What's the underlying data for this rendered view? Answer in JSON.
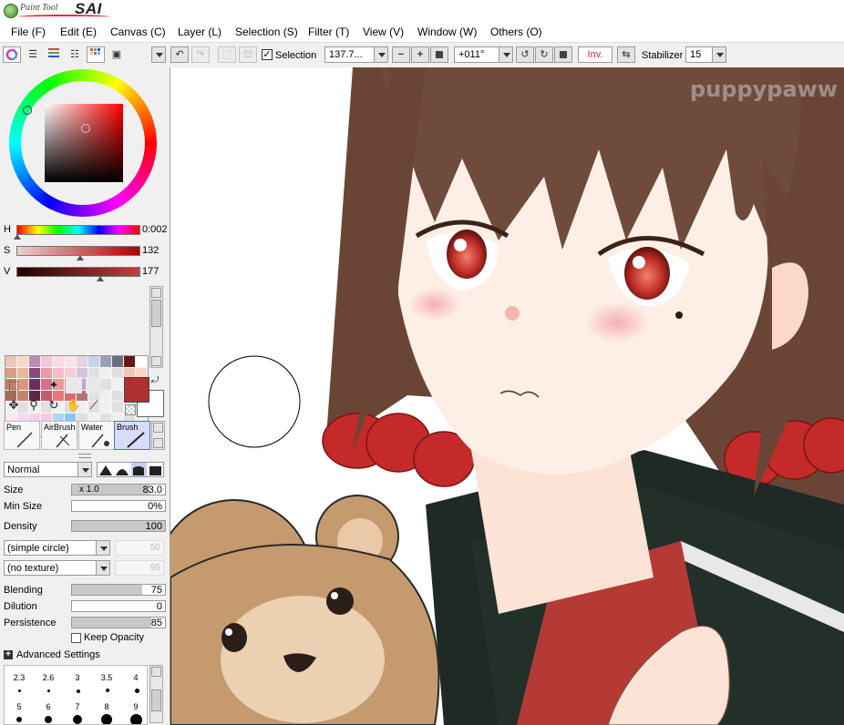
{
  "app": {
    "logo_small": "Paint Tool",
    "logo_big": "SAI"
  },
  "menu": [
    "File (F)",
    "Edit (E)",
    "Canvas (C)",
    "Layer (L)",
    "Selection (S)",
    "Filter (T)",
    "View (V)",
    "Window (W)",
    "Others (O)"
  ],
  "toolbar": {
    "selection_label": "Selection",
    "selection_checked": true,
    "zoom": "137.7...",
    "rotation": "+011°",
    "invert_label": "Inv.",
    "stabilizer_label": "Stabilizer",
    "stabilizer_value": "15"
  },
  "color": {
    "h_label": "H",
    "h_value": "0:002",
    "s_label": "S",
    "s_value": "132",
    "v_label": "V",
    "v_value": "177",
    "h_level": 0.01,
    "s_level": 0.52,
    "v_level": 0.69,
    "primary": "#b0302f",
    "secondary": "#ffffff"
  },
  "brush_tabs": [
    {
      "label": "Pen",
      "selected": false
    },
    {
      "label": "AirBrush",
      "selected": false
    },
    {
      "label": "Water",
      "selected": false
    },
    {
      "label": "Brush",
      "selected": true
    }
  ],
  "brush": {
    "blend_mode": "Normal",
    "size_label": "Size",
    "size_multiplier": "x 1.0",
    "size_value": "83.0",
    "size_level": 0.83,
    "min_size_label": "Min Size",
    "min_size_value": "0%",
    "min_size_level": 0,
    "density_label": "Density",
    "density_value": "100",
    "density_level": 1.0,
    "shape": "(simple circle)",
    "shape_value": "50",
    "texture": "(no texture)",
    "texture_value": "95",
    "blending_label": "Blending",
    "blending_value": "75",
    "blending_level": 0.75,
    "dilution_label": "Dilution",
    "dilution_value": "0",
    "dilution_level": 0,
    "persistence_label": "Persistence",
    "persistence_value": "85",
    "persistence_level": 0.85,
    "keep_opacity_label": "Keep Opacity",
    "advanced_label": "Advanced Settings"
  },
  "brush_sizes": {
    "row1": [
      "2.3",
      "2.6",
      "3",
      "3.5",
      "4"
    ],
    "row2": [
      "5",
      "6",
      "7",
      "8",
      "9"
    ]
  },
  "canvas": {
    "watermark": "puppypaww"
  }
}
